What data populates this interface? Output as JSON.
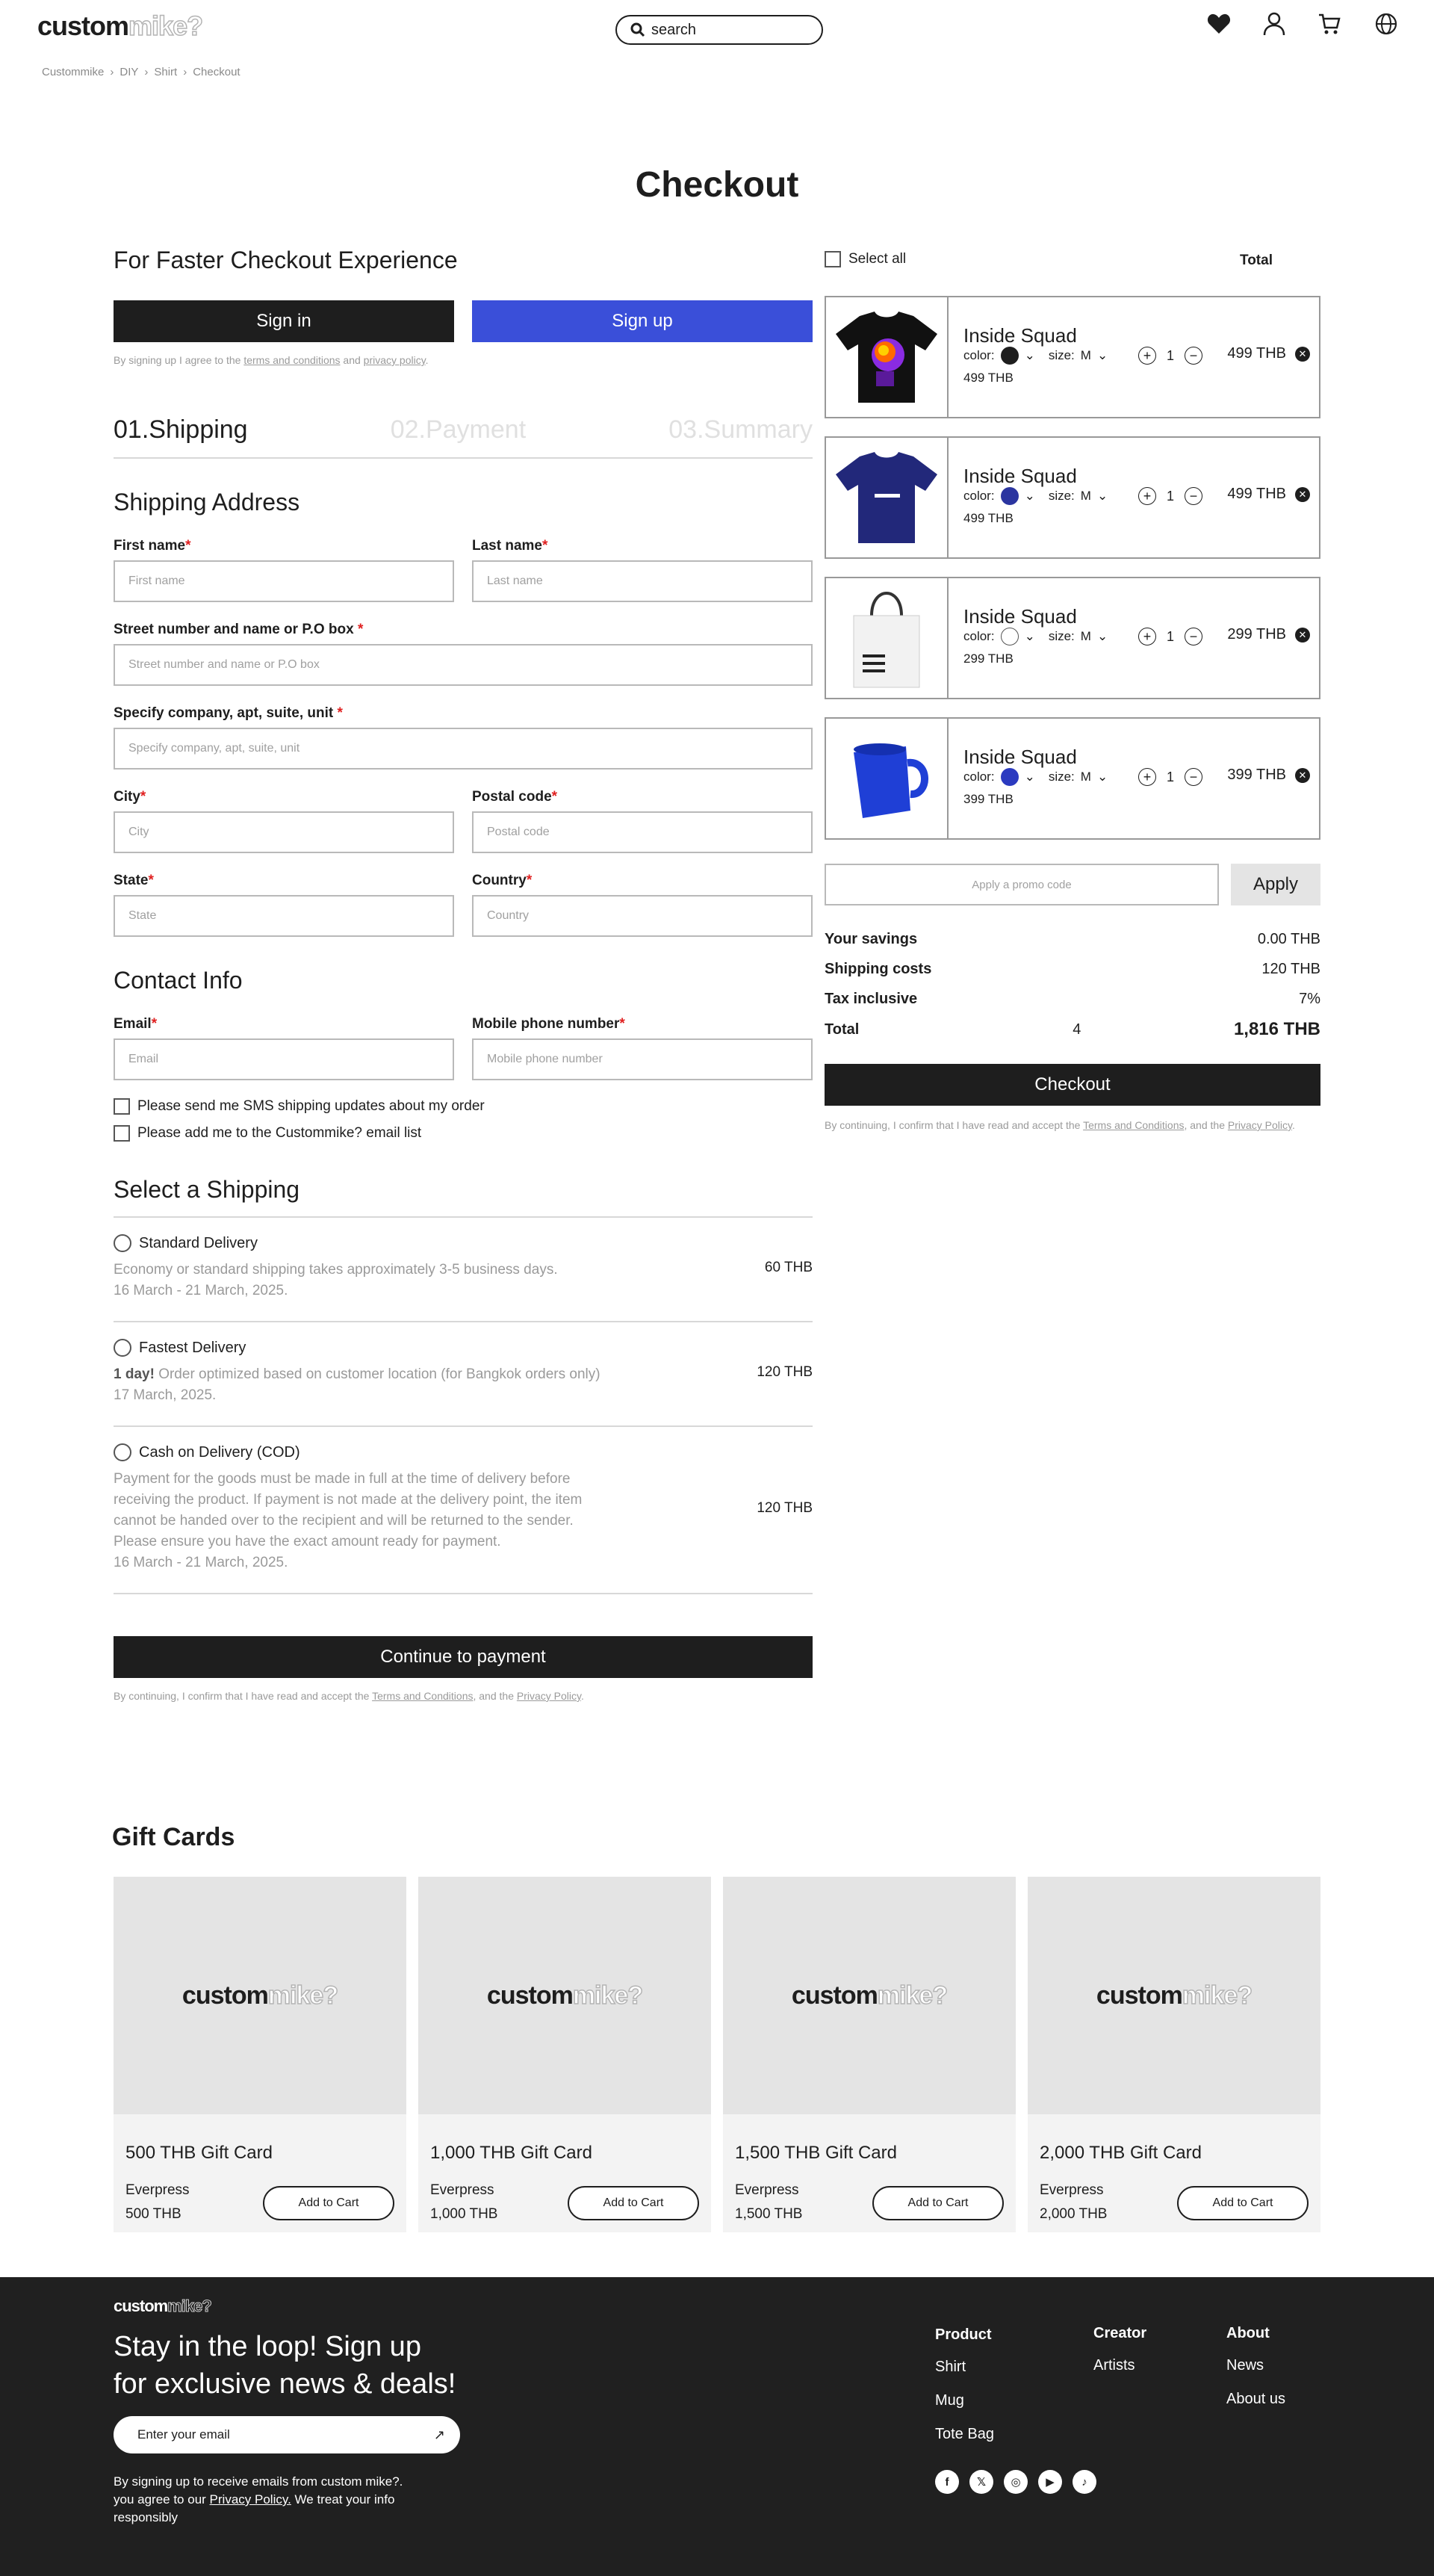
{
  "header": {
    "logo_dark": "custom",
    "logo_light": "mike?",
    "search_placeholder": "search"
  },
  "breadcrumb": [
    "Custommike",
    "DIY",
    "Shirt",
    "Checkout"
  ],
  "page_title": "Checkout",
  "faster": {
    "title": "For Faster Checkout Experience",
    "signin": "Sign in",
    "signup": "Sign up",
    "note_pre": "By signing up I agree to the",
    "terms": "terms and conditions",
    "and": "and",
    "privacy": "privacy policy",
    "dot": "."
  },
  "steps": [
    "01.Shipping",
    "02.Payment",
    "03.Summary"
  ],
  "shipping_address": {
    "title": "Shipping Address",
    "first_name_label": "First name",
    "first_name_ph": "First name",
    "last_name_label": "Last name",
    "last_name_ph": "Last name",
    "street_label": "Street number and name or P.O box ",
    "street_ph": "Street number and name or P.O box",
    "company_label": "Specify company, apt, suite, unit ",
    "company_ph": "Specify company, apt, suite, unit",
    "city_label": "City",
    "city_ph": "City",
    "postal_label": "Postal code",
    "postal_ph": "Postal code",
    "state_label": "State",
    "state_ph": "State",
    "country_label": "Country",
    "country_ph": "Country",
    "req": "*"
  },
  "contact": {
    "title": "Contact  Info",
    "email_label": "Email",
    "email_ph": "Email",
    "phone_label": "Mobile phone number",
    "phone_ph": "Mobile phone number",
    "sms": "Please send me SMS shipping updates about my order",
    "list": "Please add me to the Custommike? email list"
  },
  "shipping": {
    "title": "Select a Shipping",
    "options": [
      {
        "name": "Standard Delivery",
        "desc": "Economy or standard shipping takes approximately 3-5 business days.",
        "date": "16 March - 21 March, 2025.",
        "price": "60 THB"
      },
      {
        "name": "Fastest Delivery",
        "bold": "1 day!",
        "desc": " Order optimized based on customer location  (for Bangkok orders only)",
        "date": "17 March, 2025.",
        "price": "120 THB"
      },
      {
        "name": "Cash on Delivery (COD)",
        "desc1": "Payment for the goods must be made in full at the time of delivery before",
        "desc2": "receiving the product. If payment is not made at the delivery point, the item",
        "desc3": "cannot be handed over to the recipient and will be returned to the sender.",
        "desc4": "Please ensure you have the exact amount ready for payment.",
        "date": "16 March - 21 March, 2025.",
        "price": "120 THB"
      }
    ],
    "continue": "Continue to payment",
    "note_pre": "By continuing, I confirm that I have read and accept the",
    "terms": "Terms and Conditions",
    "mid": ", and the",
    "privacy": "Privacy Policy",
    "dot": "."
  },
  "cart": {
    "select_all": "Select all",
    "total_head": "Total",
    "color_label": "color:",
    "size_label": "size:",
    "items": [
      {
        "name": "Inside  Squad",
        "color": "#1e1e1e",
        "size": "M",
        "unit": "499 THB",
        "qty": "1",
        "price": "499 THB",
        "icon": "tshirt-black-icon"
      },
      {
        "name": "Inside  Squad",
        "color": "#2b35a0",
        "size": "M",
        "unit": "499 THB",
        "qty": "1",
        "price": "499 THB",
        "icon": "tshirt-navy-icon"
      },
      {
        "name": "Inside  Squad",
        "color": "#ffffff",
        "size": "M",
        "unit": "299 THB",
        "qty": "1",
        "price": "299 THB",
        "icon": "tote-bag-icon"
      },
      {
        "name": "Inside  Squad",
        "color": "#2b3ac0",
        "size": "M",
        "unit": "399 THB",
        "qty": "1",
        "price": "399 THB",
        "icon": "mug-icon"
      }
    ],
    "promo_ph": "Apply a promo code",
    "apply": "Apply",
    "savings_label": "Your savings",
    "savings": "0.00 THB",
    "shipping_label": "Shipping costs",
    "shipping": "120 THB",
    "tax_label": "Tax inclusive",
    "tax": "7%",
    "total_label": "Total",
    "count": "4",
    "total": "1,816 THB",
    "checkout": "Checkout",
    "note_pre": "By continuing, I confirm that I have read and accept the",
    "terms": "Terms and Conditions",
    "mid": ", and the",
    "privacy": "Privacy Policy",
    "dot": "."
  },
  "gift": {
    "title": "Gift Cards",
    "brand": "Everpress",
    "add": "Add to Cart",
    "cards": [
      {
        "title": "500 THB  Gift Card",
        "value": "500 THB"
      },
      {
        "title": "1,000 THB  Gift Card",
        "value": "1,000 THB"
      },
      {
        "title": "1,500 THB  Gift Card",
        "value": "1,500 THB"
      },
      {
        "title": "2,000 THB  Gift Card",
        "value": "2,000 THB"
      }
    ]
  },
  "footer": {
    "headline1": "Stay in the loop! Sign up",
    "headline2": "for exclusive news & deals!",
    "email_ph": "Enter your email",
    "note1": "By signing up to receive emails from custom mike?.",
    "note2_pre": "you agree to our",
    "privacy": "Privacy Policy.",
    "note2_post": " We treat your info",
    "note3": "responsibly",
    "product_head": "Product",
    "product": [
      "Shirt",
      "Mug",
      "Tote Bag"
    ],
    "creator_head": "Creator",
    "creator": [
      "Artists"
    ],
    "about_head": "About",
    "about": [
      "News",
      "About us"
    ],
    "social": [
      "facebook-icon",
      "x-icon",
      "instagram-icon",
      "youtube-icon",
      "tiktok-icon"
    ]
  }
}
